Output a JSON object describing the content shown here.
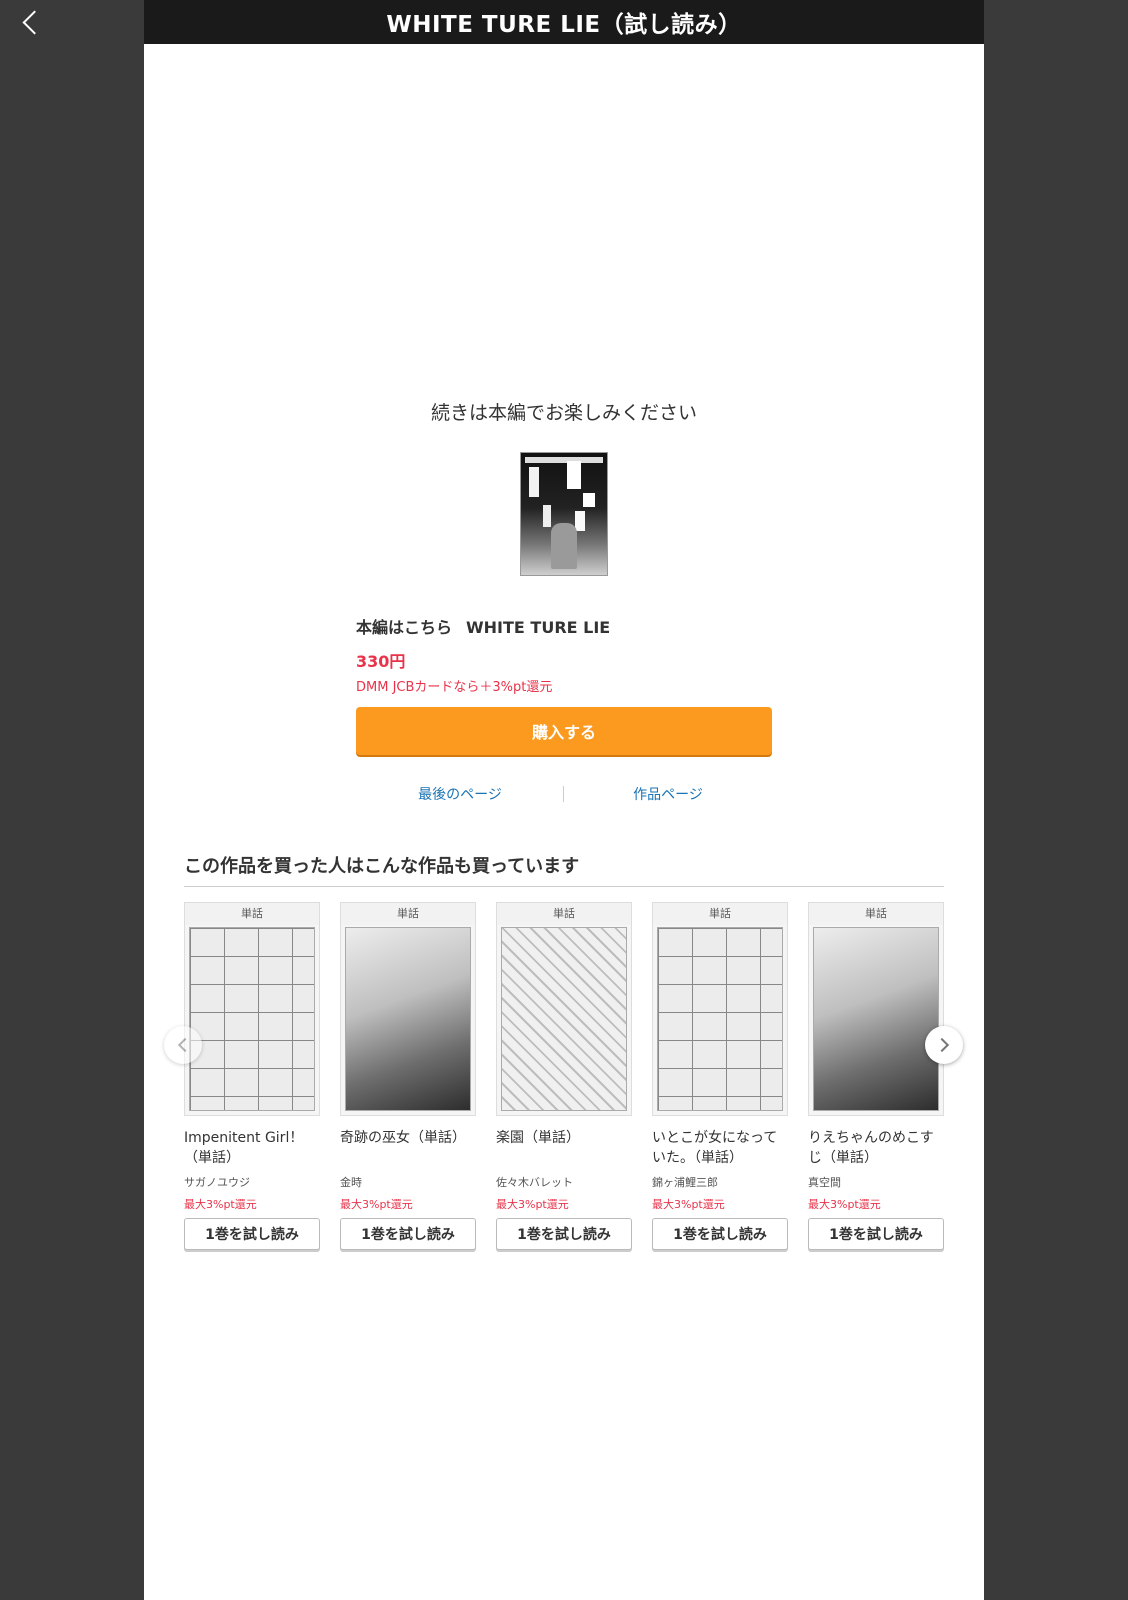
{
  "header": {
    "title": "WHITE TURE LIE（試し読み）",
    "back_icon": "chevron-left-icon"
  },
  "end_of_sample": {
    "message": "続きは本編でお楽しみください",
    "main_label": "本編はこちら",
    "work_title": "WHITE TURE LIE",
    "price": "330円",
    "campaign": "DMM JCBカードなら＋3%pt還元",
    "buy_label": "購入する",
    "last_page_label": "最後のページ",
    "work_page_label": "作品ページ"
  },
  "recommendations": {
    "heading": "この作品を買った人はこんな作品も買っています",
    "items": [
      {
        "tag": "単話",
        "name": "Impenitent Girl！（単話）",
        "author": "サガノユウジ",
        "pt": "最大3%pt還元",
        "button": "1巻を試し読み"
      },
      {
        "tag": "単話",
        "name": "奇跡の巫女（単話）",
        "author": "金時",
        "pt": "最大3%pt還元",
        "button": "1巻を試し読み"
      },
      {
        "tag": "単話",
        "name": "楽園（単話）",
        "author": "佐々木バレット",
        "pt": "最大3%pt還元",
        "button": "1巻を試し読み"
      },
      {
        "tag": "単話",
        "name": "いとこが女になっていた。（単話）",
        "author": "錦ヶ浦鯉三郎",
        "pt": "最大3%pt還元",
        "button": "1巻を試し読み"
      },
      {
        "tag": "単話",
        "name": "りえちゃんのめこすじ（単話）",
        "author": "真空間",
        "pt": "最大3%pt還元",
        "button": "1巻を試し読み"
      }
    ],
    "prev_icon": "chevron-left-icon",
    "next_icon": "chevron-right-icon"
  },
  "colors": {
    "accent": "#fb9a1f",
    "price": "#e8334a",
    "link": "#1a73b5",
    "header_bg": "#1a1a1a"
  }
}
